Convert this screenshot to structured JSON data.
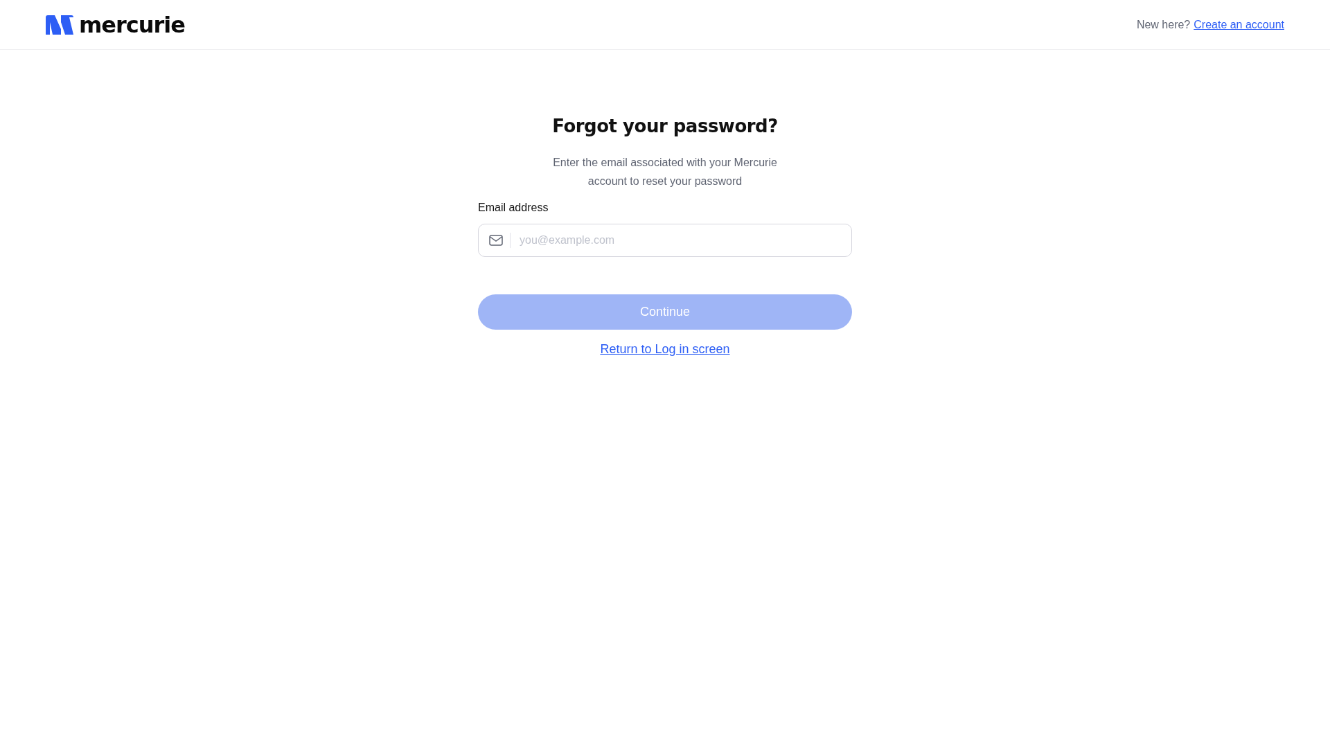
{
  "header": {
    "logo_text": "mercurie",
    "prompt": "New here?",
    "link": "Create an account"
  },
  "form": {
    "title": "Forgot your password?",
    "description": "Enter the email associated with your Mercurie account to reset your password",
    "email": {
      "label": "Email address",
      "placeholder": "you@example.com"
    },
    "submit": {
      "label": "Continue",
      "disabled": true
    },
    "back_link": "Return to Log in screen"
  }
}
